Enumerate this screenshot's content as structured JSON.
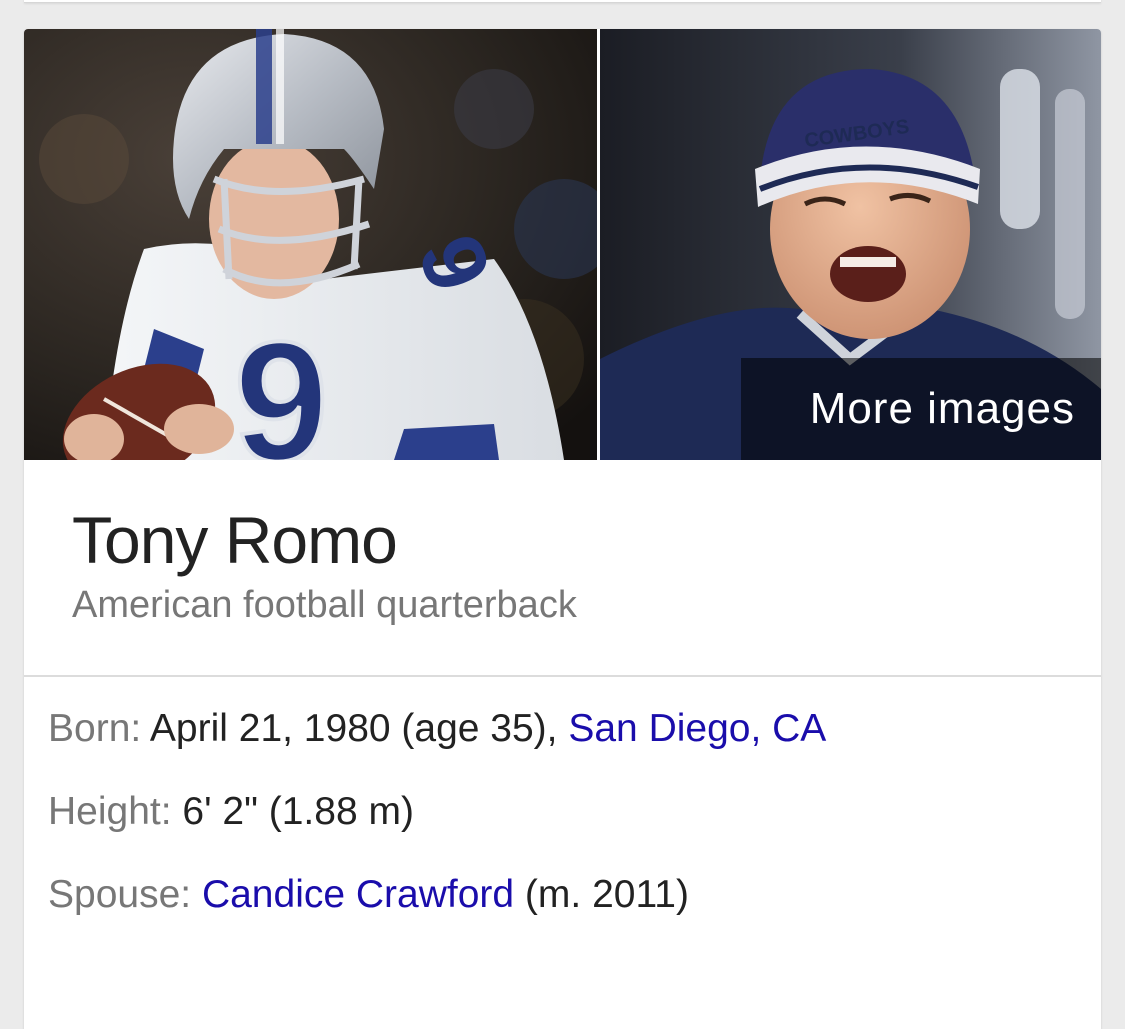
{
  "images": {
    "left_alt": "Tony Romo in Cowboys uniform holding football",
    "right_alt": "Tony Romo wearing Cowboys beanie",
    "more_images_label": "More images"
  },
  "entity": {
    "title": "Tony Romo",
    "subtitle": "American football quarterback"
  },
  "facts": {
    "born": {
      "label": "Born:",
      "value": " April 21, 1980 (age 35), ",
      "link": "San Diego, CA"
    },
    "height": {
      "label": "Height:",
      "value": " 6' 2\" (1.88 m)"
    },
    "spouse": {
      "label": "Spouse:",
      "link": "Candice Crawford",
      "value_after": " (m. 2011)"
    }
  },
  "colors": {
    "link": "#1a0dab",
    "label": "#777777",
    "text": "#222222",
    "background": "#ebebeb"
  }
}
